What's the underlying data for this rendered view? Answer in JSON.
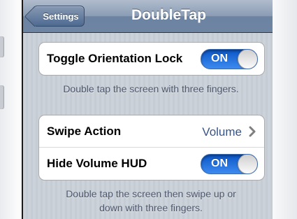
{
  "navbar": {
    "back_label": "Settings",
    "title": "DoubleTap"
  },
  "group1": {
    "rows": [
      {
        "label": "Toggle Orientation Lock",
        "switch": "ON"
      }
    ],
    "footer": "Double tap the screen with three fingers."
  },
  "group2": {
    "rows": [
      {
        "label": "Swipe Action",
        "value": "Volume"
      },
      {
        "label": "Hide Volume HUD",
        "switch": "ON"
      }
    ],
    "footer_line1": "Double tap the screen then swipe up or",
    "footer_line2": "down with three fingers."
  },
  "icons": {
    "back": "back-arrow-icon",
    "disclosure": "chevron-right-icon"
  },
  "colors": {
    "switch_on": "#2a78e4",
    "nav_bar": "#6d84a3",
    "value_text": "#385487"
  }
}
